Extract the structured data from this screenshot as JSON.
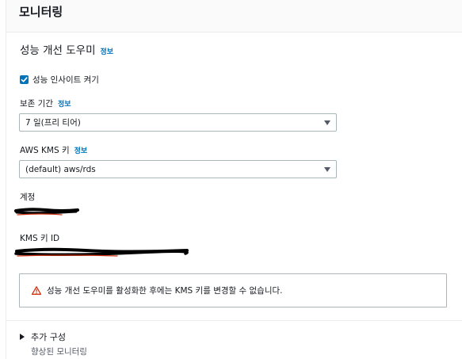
{
  "header": {
    "title": "모니터링"
  },
  "section": {
    "title": "성능 개선 도우미",
    "info": "정보"
  },
  "checkbox": {
    "label": "성능 인사이트 켜기",
    "checked": true
  },
  "retention": {
    "label": "보존 기간",
    "info": "정보",
    "value": "7 일(프리 티어)"
  },
  "kms": {
    "label": "AWS KMS 키",
    "info": "정보",
    "value": "(default) aws/rds"
  },
  "account": {
    "label": "계정"
  },
  "kms_key_id": {
    "label": "KMS 키 ID"
  },
  "warning": {
    "text": "성능 개선 도우미를 활성화한 후에는 KMS 키를 변경할 수 없습니다.",
    "icon": "warning-triangle-icon",
    "color": "#d13212"
  },
  "additional": {
    "label": "추가 구성",
    "description": "향상된 모니터링"
  },
  "colors": {
    "accent": "#0073bb",
    "redaction": "#000000",
    "redaction_underline": "#d13212"
  }
}
